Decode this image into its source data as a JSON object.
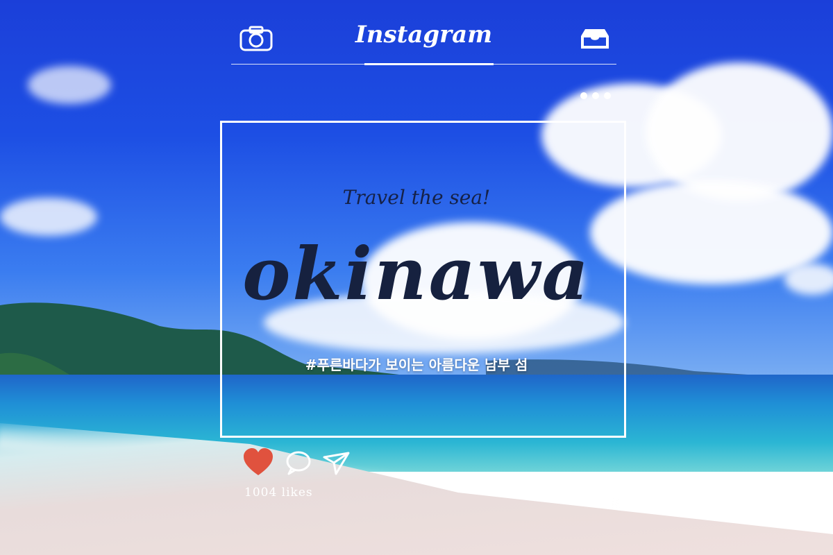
{
  "app": {
    "brand": "Instagram"
  },
  "header": {
    "camera_icon": "camera-icon",
    "inbox_icon": "inbox-icon"
  },
  "post": {
    "tagline": "Travel the sea!",
    "headline": "okinawa",
    "caption": "#푸른바다가 보이는 아름다운 남부 섬"
  },
  "actions": {
    "like_icon": "heart-icon",
    "comment_icon": "comment-icon",
    "share_icon": "send-icon",
    "likes": "1004 likes"
  },
  "colors": {
    "heart": "#e0523e",
    "headline": "#16213f"
  }
}
